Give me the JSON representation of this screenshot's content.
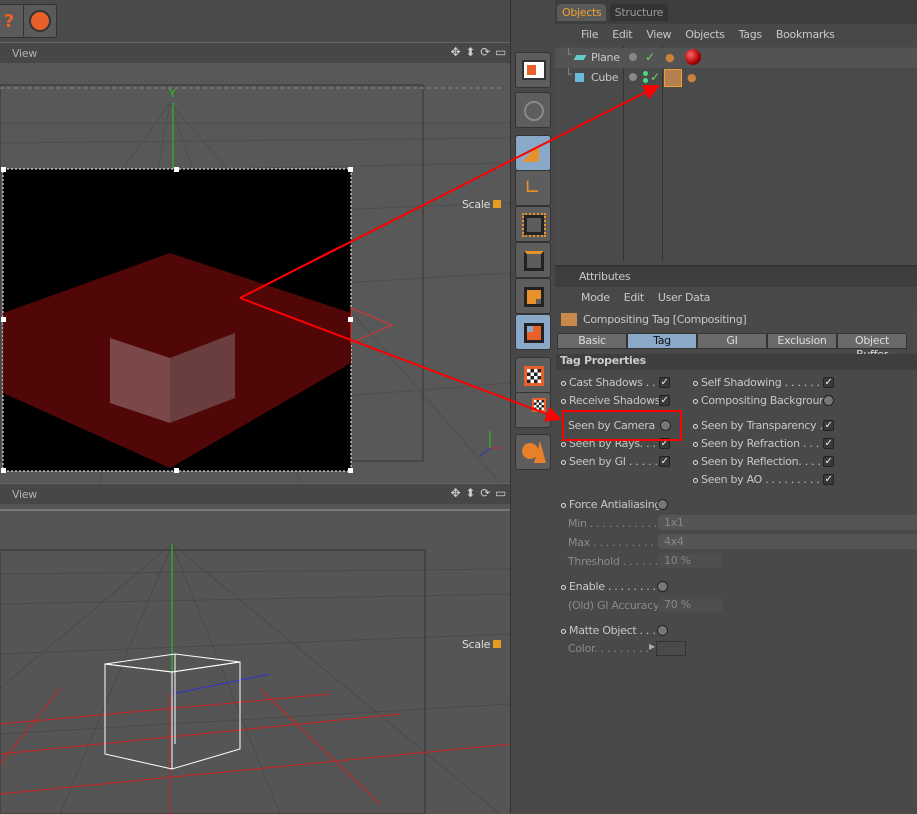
{
  "toolbar_top": {
    "buttons": [
      {
        "icon": "help-icon"
      },
      {
        "icon": "globe-render-icon"
      }
    ]
  },
  "viewports": [
    {
      "label": "View",
      "hud": "Scale",
      "nav_icons": [
        "move-icon",
        "zoom-icon",
        "rotate-icon",
        "maximize-icon"
      ]
    },
    {
      "label": "View",
      "hud": "Scale",
      "nav_icons": [
        "move-icon",
        "zoom-icon",
        "rotate-icon",
        "maximize-icon"
      ]
    }
  ],
  "palette": {
    "tools": [
      "layout-icon",
      "globe-scene-icon",
      "model-mode-icon",
      "object-axis-icon",
      "points-icon",
      "edges-icon",
      "polygons-icon",
      "uv-icon",
      "texture-icon",
      "texture-axis-icon",
      "sculpt-icon"
    ],
    "active": [
      2,
      7
    ]
  },
  "objects": {
    "tabs": [
      "Objects",
      "Structure"
    ],
    "active_tab": "Objects",
    "menu": [
      "File",
      "Edit",
      "View",
      "Objects",
      "Tags",
      "Bookmarks"
    ],
    "items": [
      {
        "name": "Plane",
        "icon": "plane-icon",
        "tags": [
          "phong-tag-icon",
          "material-tag-icon"
        ]
      },
      {
        "name": "Cube",
        "icon": "cube-icon",
        "tags": [
          "compositing-tag-icon",
          "phong-tag-icon"
        ]
      }
    ]
  },
  "attributes": {
    "title": "Attributes",
    "menu": [
      "Mode",
      "Edit",
      "User Data"
    ],
    "header": "Compositing Tag [Compositing]",
    "tabs": [
      "Basic",
      "Tag",
      "GI",
      "Exclusion",
      "Object Buffer"
    ],
    "active_tab": "Tag",
    "section": "Tag Properties",
    "left": [
      {
        "label": "Cast Shadows . . .",
        "checked": true
      },
      {
        "label": "Receive Shadows",
        "checked": true
      },
      {
        "label": "Seen by Camera",
        "checked": false
      },
      {
        "label": "Seen by Rays. . . .",
        "checked": true
      },
      {
        "label": "Seen by GI . . . . . .",
        "checked": true
      }
    ],
    "right": [
      {
        "label": "Self Shadowing . . . . . . . .",
        "checked": true
      },
      {
        "label": "Compositing Background",
        "checked": false
      },
      {
        "label": "Seen by Transparency . .",
        "checked": true
      },
      {
        "label": "Seen by Refraction . . . .",
        "checked": true
      },
      {
        "label": "Seen by Reflection. . . . .",
        "checked": true
      },
      {
        "label": "Seen by AO . . . . . . . . . .",
        "checked": true
      }
    ],
    "force_aa": {
      "label": "Force Antialiasing",
      "checked": false,
      "min_label": "Min . . . . . . . . . . . .",
      "min": "1x1",
      "max_label": "Max . . . . . . . . . . .",
      "max": "4x4",
      "threshold_label": "Threshold . . . . . .",
      "threshold": "10 %"
    },
    "gi": {
      "label": "Enable . . . . . . . . .",
      "checked": false,
      "accuracy_label": "(Old) GI Accuracy",
      "accuracy": "70 %"
    },
    "matte": {
      "label": "Matte Object . . .",
      "checked": false,
      "color_label": "Color. . . . . . . . ."
    }
  },
  "colors": {
    "accent": "#e89b20",
    "annotation": "#ff0000",
    "active_tab": "#8aa9c9"
  }
}
